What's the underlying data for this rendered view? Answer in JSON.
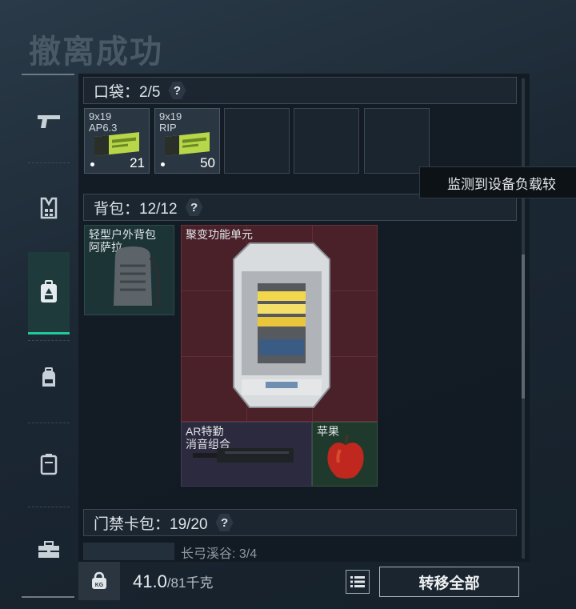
{
  "title": "撤离成功",
  "sidebar": {
    "items": [
      {
        "icon": "pistol-icon"
      },
      {
        "icon": "vest-icon"
      },
      {
        "icon": "backpack-icon",
        "active": true
      },
      {
        "icon": "bag-icon"
      },
      {
        "icon": "case-icon"
      },
      {
        "icon": "toolbox-icon"
      }
    ]
  },
  "pockets": {
    "label": "口袋：2/5",
    "help": "?",
    "slots": [
      {
        "name": "9x19\nAP6.3",
        "count": "21"
      },
      {
        "name": "9x19\nRIP",
        "count": "50"
      }
    ]
  },
  "backpack": {
    "label": "背包：12/12",
    "help": "?",
    "items": {
      "bag_name": "轻型户外背包\n阿萨拉",
      "fusion_name": "聚变功能单元",
      "ar_name": "AR特勤\n消音组合",
      "apple_name": "苹果"
    }
  },
  "tooltip": "监测到设备负载较",
  "keycard": {
    "label": "门禁卡包：19/20",
    "help": "?",
    "row_text": "长弓溪谷: 3/4"
  },
  "footer": {
    "weight": "41.0",
    "max": "/81千克",
    "weight_icon_label": "KG",
    "transfer_label": "转移全部"
  },
  "colors": {
    "accent": "#22c79a",
    "fusion_bg": "#4a2128",
    "apple_bg": "#1f3a2c"
  }
}
